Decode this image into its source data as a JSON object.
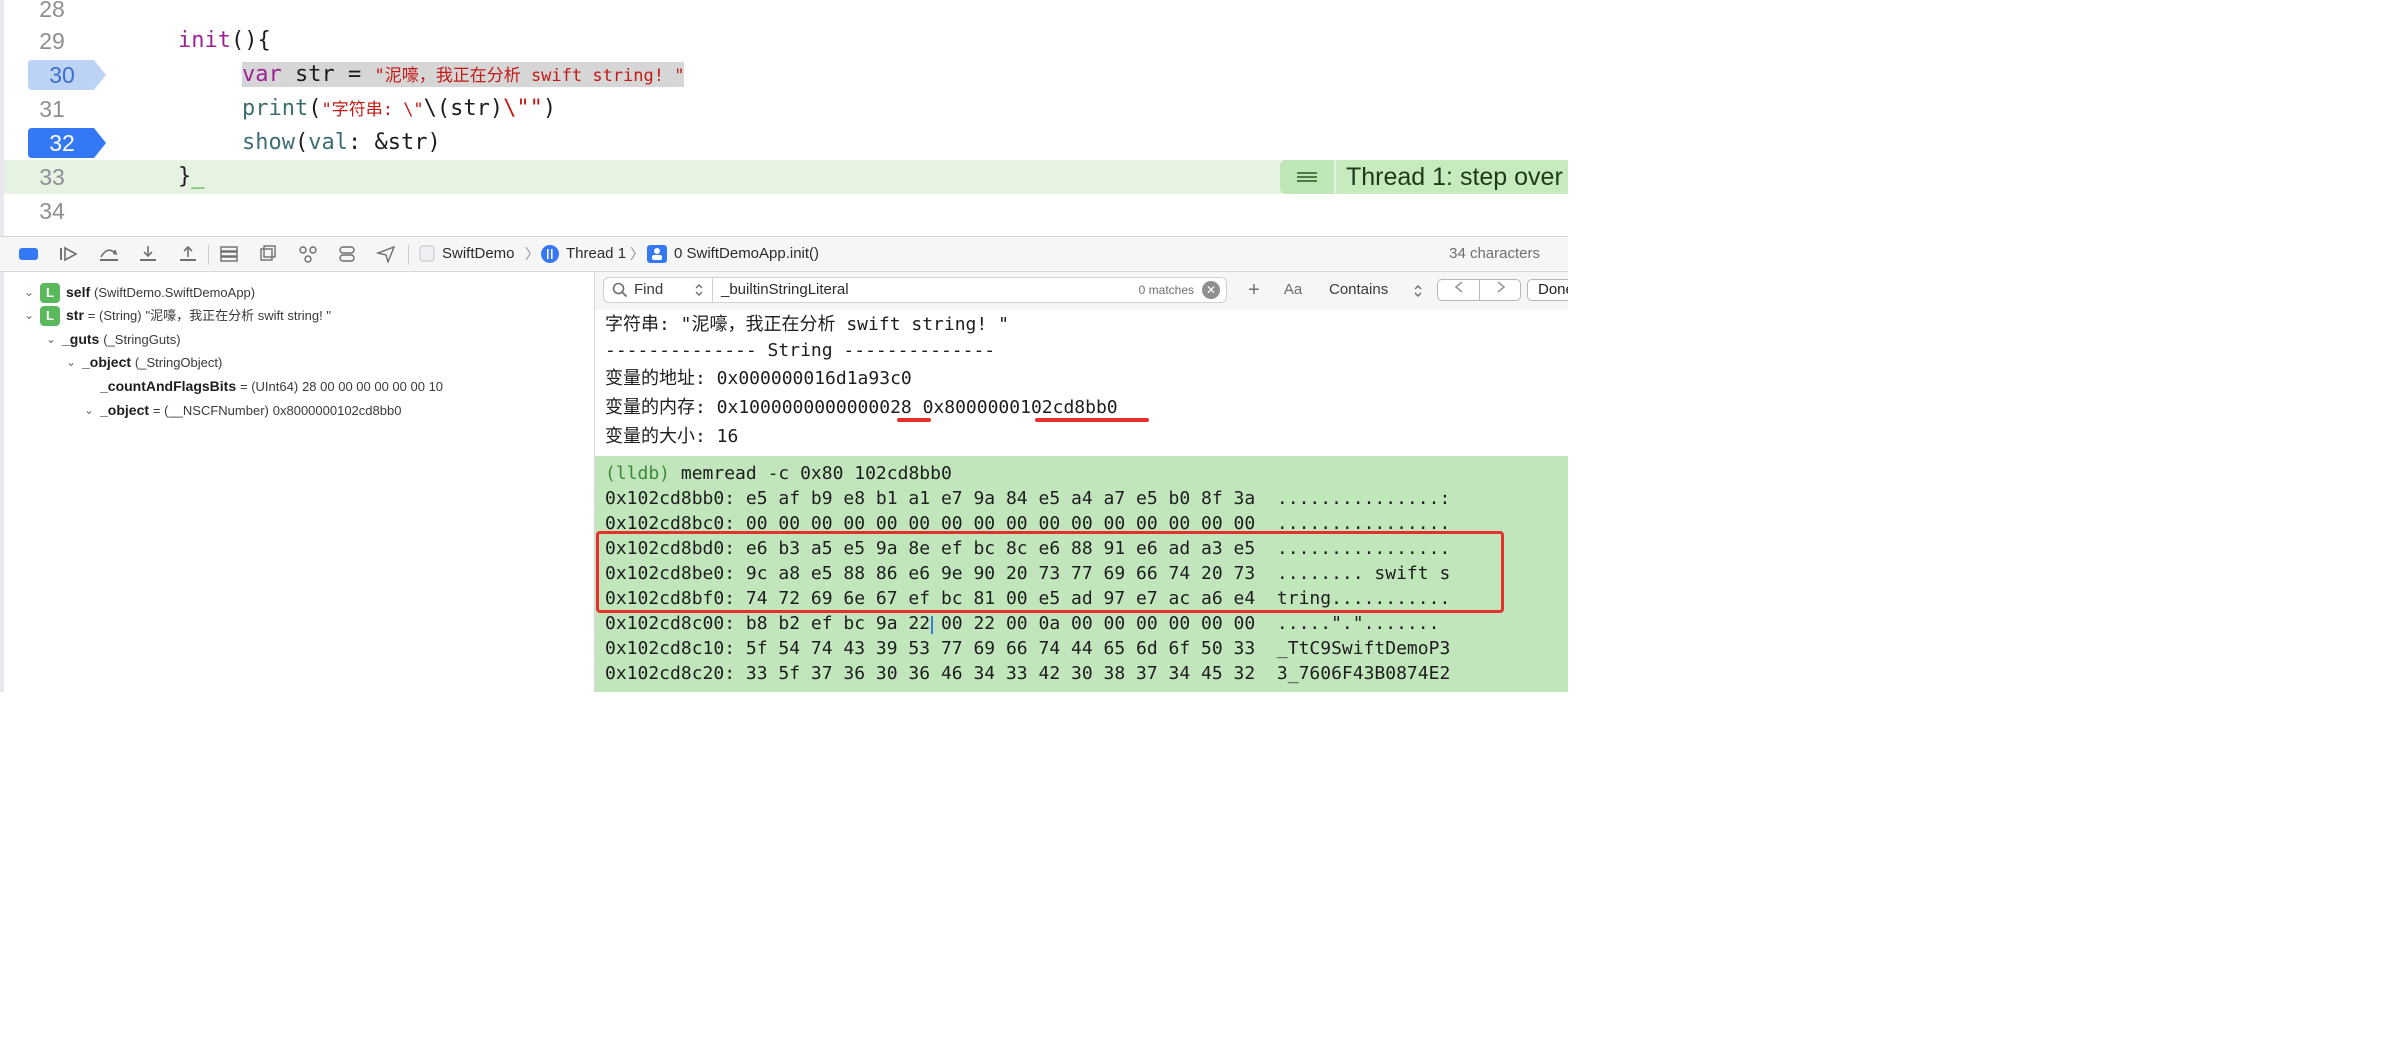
{
  "editor": {
    "lines": [
      {
        "num": "28",
        "code": ""
      },
      {
        "num": "29",
        "code": "init(){"
      },
      {
        "num": "30",
        "code": "var str = \"泥嚎，我正在分析 swift string! \""
      },
      {
        "num": "31",
        "code": "print(\"字符串: \\\"\\(str)\\\"\")"
      },
      {
        "num": "32",
        "code": "show(val: &str)"
      },
      {
        "num": "33",
        "code": "}"
      },
      {
        "num": "34",
        "code": ""
      }
    ],
    "tokens": {
      "l29_kw": "init",
      "l29_rest": "(){",
      "l30_kw": "var",
      "l30_mid": " str = ",
      "l30_str": "\"泥嚎，我正在分析 swift string! \"",
      "l31_fn": "print",
      "l31_p1": "(",
      "l31_s1": "\"字符串: \\\"",
      "l31_interp": "\\(str)",
      "l31_s2": "\\\"\"",
      "l31_p2": ")",
      "l32_fn": "show",
      "l32_p1": "(",
      "l32_arg": "val",
      "l32_rest": ": &str)",
      "l33_brace": "}",
      "l33_cursor": "_"
    },
    "status": "Thread 1: step over"
  },
  "toolbar": {
    "breadcrumbs": [
      "SwiftDemo",
      "Thread 1",
      "0 SwiftDemoApp.init()"
    ],
    "char_count": "34 characters"
  },
  "variables": [
    {
      "badge": "L",
      "name": "self",
      "type": "(SwiftDemo.SwiftDemoApp)",
      "value": ""
    },
    {
      "badge": "L",
      "name": "str",
      "type": "= (String)",
      "value": "\"泥嚎，我正在分析 swift string! \""
    },
    {
      "badge": "",
      "name": "_guts",
      "type": "(_StringGuts)",
      "value": ""
    },
    {
      "badge": "",
      "name": "_object",
      "type": "(_StringObject)",
      "value": ""
    },
    {
      "badge": "",
      "name": "_countAndFlagsBits",
      "type": "= (UInt64)",
      "value": "28 00 00 00 00 00 00 10"
    },
    {
      "badge": "",
      "name": "_object",
      "type": "= (__NSCFNumber)",
      "value": "0x8000000102cd8bb0"
    }
  ],
  "find": {
    "mode": "Find",
    "query": "_builtinStringLiteral",
    "matches": "0 matches",
    "plus": "+",
    "case": "Aa",
    "contains": "Contains",
    "done": "Done"
  },
  "console": {
    "output": [
      "字符串: \"泥嚎，我正在分析 swift string! \"",
      "-------------- String --------------",
      "变量的地址: 0x000000016d1a93c0",
      "变量的内存: 0x1000000000000028 0x8000000102cd8bb0",
      "变量的大小: 16"
    ],
    "lldb_prompt": "(lldb)",
    "lldb_command": " memread -c 0x80 102cd8bb0",
    "lldb_rows": [
      "0x102cd8bb0: e5 af b9 e8 b1 a1 e7 9a 84 e5 a4 a7 e5 b0 8f 3a  ...............:",
      "0x102cd8bc0: 00 00 00 00 00 00 00 00 00 00 00 00 00 00 00 00  ................",
      "0x102cd8bd0: e6 b3 a5 e5 9a 8e ef bc 8c e6 88 91 e6 ad a3 e5  ................",
      "0x102cd8be0: 9c a8 e5 88 86 e6 9e 90 20 73 77 69 66 74 20 73  ........ swift s",
      "0x102cd8bf0: 74 72 69 6e 67 ef bc 81 00 e5 ad 97 e7 ac a6 e4  tring...........",
      "0x102cd8c00: b8 b2 ef bc 9a 22 00 22 00 0a 00 00 00 00 00 00  .....\".\".......",
      "0x102cd8c10: 5f 54 74 43 39 53 77 69 66 74 44 65 6d 6f 50 33  _TtC9SwiftDemoP3",
      "0x102cd8c20: 33 5f 37 36 30 36 46 34 33 42 30 38 37 34 45 32  3_7606F43B0874E2"
    ]
  },
  "colors": {
    "keyword": "#9b2393",
    "string": "#c41a16",
    "function": "#3e6d74",
    "breakpoint_active": "#3478f6",
    "breakpoint_inactive": "#bcd3f5",
    "exec_line": "#e6f3e2",
    "lldb_bg": "#c2e6bb",
    "annotation_red": "#e5302b"
  }
}
